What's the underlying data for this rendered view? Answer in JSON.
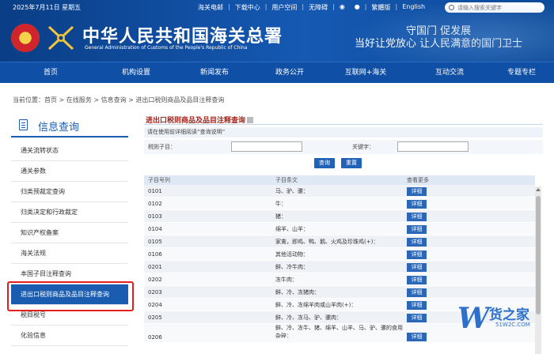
{
  "header": {
    "date": "2025年7月11日 星期五",
    "top_links": [
      "海关电邮",
      "下载中心",
      "用户空间",
      "无障碍",
      "繁體版",
      "English"
    ],
    "search_placeholder": "请输入搜索关键字",
    "title_zh": "中华人民共和国海关总署",
    "title_en": "General Administration of Customs of the People's Republic of China",
    "slogan_line1": "守国门   促发展",
    "slogan_line2": "当好让党放心   让人民满意的国门卫士"
  },
  "nav": [
    "首页",
    "机构设置",
    "新闻发布",
    "政务公开",
    "互联网+海关",
    "互动交流",
    "专题专栏"
  ],
  "breadcrumb": "当前位置：首页 > 在线服务 > 信息查询 > 进出口税则商品及品目注释查询",
  "sidebar": {
    "title": "信息查询",
    "items": [
      {
        "label": "通关流转状态"
      },
      {
        "label": "通关参数"
      },
      {
        "label": "归类预裁定查询"
      },
      {
        "label": "归类决定和行政裁定"
      },
      {
        "label": "知识产权备案"
      },
      {
        "label": "海关法规"
      },
      {
        "label": "本国子目注释查询"
      },
      {
        "label": "进出口税则商品及品目注释查询"
      },
      {
        "label": "税目税号"
      },
      {
        "label": "化验信息"
      }
    ]
  },
  "panel": {
    "title": "进出口税则商品及品目注释查询",
    "hint": "请在使用前详细阅读“查询说明”",
    "tax_item_label": "税则子目：",
    "keyword_label": "关键字：",
    "query_button": "查询",
    "reset_button": "重置"
  },
  "table": {
    "headers": [
      "子目号列",
      "子目条文",
      "查看更多"
    ],
    "detail_label": "详细",
    "rows": [
      {
        "code": "0101",
        "text": "马、驴、骡："
      },
      {
        "code": "0102",
        "text": "牛："
      },
      {
        "code": "0103",
        "text": "猪："
      },
      {
        "code": "0104",
        "text": "绵羊、山羊："
      },
      {
        "code": "0105",
        "text": "家禽，即鸡、鸭、鹅、火鸡及珍珠鸡(+)："
      },
      {
        "code": "0106",
        "text": "其他活动物："
      },
      {
        "code": "0201",
        "text": "鲜、冷牛肉："
      },
      {
        "code": "0202",
        "text": "冻牛肉："
      },
      {
        "code": "0203",
        "text": "鲜、冷、冻猪肉："
      },
      {
        "code": "0204",
        "text": "鲜、冷、冻绵羊肉或山羊肉(+)："
      },
      {
        "code": "0205",
        "text": "鲜、冷、冻马、驴、骡肉："
      },
      {
        "code": "0206",
        "text": "鲜、冷、冻牛、猪、绵羊、山羊、马、驴、骡的食用杂碎："
      }
    ]
  },
  "watermark": {
    "letter": "W",
    "zh": "货之家",
    "url": "51W2C.COM"
  },
  "colors": {
    "header_blue": "#0f4fa6",
    "active_blue": "#1a5db0",
    "highlight_red": "#e41d1d",
    "title_red": "#a0231a"
  }
}
